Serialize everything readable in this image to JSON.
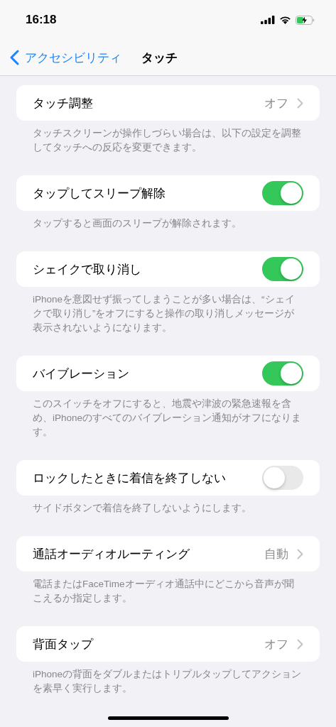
{
  "status_bar": {
    "time": "16:18"
  },
  "nav": {
    "back": "アクセシビリティ",
    "title": "タッチ"
  },
  "sections": [
    {
      "kind": "link",
      "label": "タッチ調整",
      "value": "オフ",
      "footer": "タッチスクリーンが操作しづらい場合は、以下の設定を調整してタッチへの反応を変更できます。"
    },
    {
      "kind": "toggle",
      "label": "タップしてスリープ解除",
      "on": true,
      "footer": "タップすると画面のスリープが解除されます。"
    },
    {
      "kind": "toggle",
      "label": "シェイクで取り消し",
      "on": true,
      "footer": "iPhoneを意図せず振ってしまうことが多い場合は、“シェイクで取り消し”をオフにすると操作の取り消しメッセージが表示されないようになります。"
    },
    {
      "kind": "toggle",
      "label": "バイブレーション",
      "on": true,
      "footer": "このスイッチをオフにすると、地震や津波の緊急速報を含め、iPhoneのすべてのバイブレーション通知がオフになります。"
    },
    {
      "kind": "toggle",
      "label": "ロックしたときに着信を終了しない",
      "on": false,
      "footer": "サイドボタンで着信を終了しないようにします。"
    },
    {
      "kind": "link",
      "label": "通話オーディオルーティング",
      "value": "自動",
      "footer": "電話またはFaceTimeオーディオ通話中にどこから音声が聞こえるか指定します。"
    },
    {
      "kind": "link",
      "label": "背面タップ",
      "value": "オフ",
      "footer": "iPhoneの背面をダブルまたはトリプルタップしてアクションを素早く実行します。"
    }
  ]
}
